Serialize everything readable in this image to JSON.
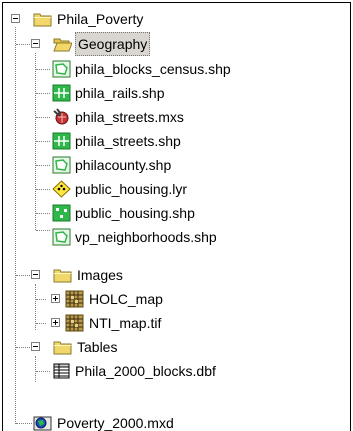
{
  "tree": {
    "root": {
      "label": "Phila_Poverty",
      "icon": "folder-closed-icon"
    },
    "geography": {
      "label": "Geography",
      "icon": "folder-open-icon",
      "items": [
        {
          "label": "phila_blocks_census.shp",
          "icon": "polygon-shapefile-icon"
        },
        {
          "label": "phila_rails.shp",
          "icon": "line-shapefile-icon"
        },
        {
          "label": "phila_streets.mxs",
          "icon": "globe-map-icon"
        },
        {
          "label": "phila_streets.shp",
          "icon": "line-shapefile-icon"
        },
        {
          "label": "philacounty.shp",
          "icon": "polygon-shapefile-icon"
        },
        {
          "label": "public_housing.lyr",
          "icon": "layer-file-icon"
        },
        {
          "label": "public_housing.shp",
          "icon": "point-shapefile-icon"
        },
        {
          "label": "vp_neighborhoods.shp",
          "icon": "polygon-shapefile-icon"
        }
      ]
    },
    "images": {
      "label": "Images",
      "icon": "folder-closed-icon",
      "items": [
        {
          "label": "HOLC_map",
          "icon": "raster-grid-icon"
        },
        {
          "label": "NTI_map.tif",
          "icon": "raster-grid-icon"
        }
      ]
    },
    "tables": {
      "label": "Tables",
      "icon": "folder-closed-icon",
      "items": [
        {
          "label": "Phila_2000_blocks.dbf",
          "icon": "table-icon"
        }
      ]
    },
    "mxd": {
      "label": "Poverty_2000.mxd",
      "icon": "map-document-icon"
    }
  },
  "colors": {
    "folder": "#f2d86a",
    "folder_edge": "#8a7a2a",
    "shp_green": "#2fb84a",
    "selected_bg": "#d8d6cf"
  }
}
